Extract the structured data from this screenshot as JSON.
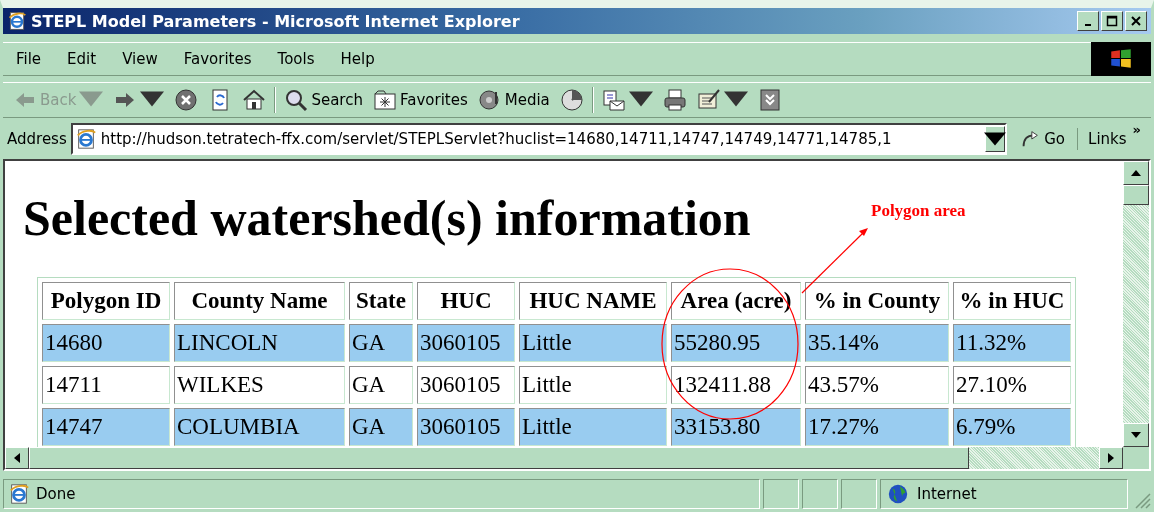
{
  "window": {
    "title": "STEPL Model Parameters - Microsoft Internet Explorer"
  },
  "menu": [
    "File",
    "Edit",
    "View",
    "Favorites",
    "Tools",
    "Help"
  ],
  "toolbar": [
    {
      "kind": "back",
      "label": "Back",
      "disabled": true
    },
    {
      "kind": "forward",
      "disabled": false
    },
    {
      "kind": "stop"
    },
    {
      "kind": "refresh"
    },
    {
      "kind": "home"
    },
    {
      "kind": "search",
      "label": "Search"
    },
    {
      "kind": "favorites",
      "label": "Favorites"
    },
    {
      "kind": "media",
      "label": "Media"
    },
    {
      "kind": "history"
    },
    {
      "kind": "mail"
    },
    {
      "kind": "print"
    },
    {
      "kind": "edit"
    },
    {
      "kind": "discuss"
    }
  ],
  "address": {
    "label": "Address",
    "value": "http://hudson.tetratech-ffx.com/servlet/STEPLServlet?huclist=14680,14711,14747,14749,14771,14785,1",
    "go": "Go",
    "links": "Links",
    "links_more": "»"
  },
  "page": {
    "heading": "Selected watershed(s) information",
    "table": {
      "columns": [
        "Polygon ID",
        "County Name",
        "State",
        "HUC",
        "HUC NAME",
        "Area (acre)",
        "% in County",
        "% in HUC"
      ],
      "rows": [
        {
          "shaded": true,
          "cells": [
            "14680",
            "LINCOLN",
            "GA",
            "3060105",
            "Little",
            "55280.95",
            "35.14%",
            "11.32%"
          ]
        },
        {
          "shaded": false,
          "cells": [
            "14711",
            "WILKES",
            "GA",
            "3060105",
            "Little",
            "132411.88",
            "43.57%",
            "27.10%"
          ]
        },
        {
          "shaded": true,
          "cells": [
            "14747",
            "COLUMBIA",
            "GA",
            "3060105",
            "Little",
            "33153.80",
            "17.27%",
            "6.79%"
          ]
        }
      ]
    },
    "annotation": {
      "label": "Polygon area"
    }
  },
  "status_bar": {
    "text": "Done",
    "zone": "Internet"
  }
}
